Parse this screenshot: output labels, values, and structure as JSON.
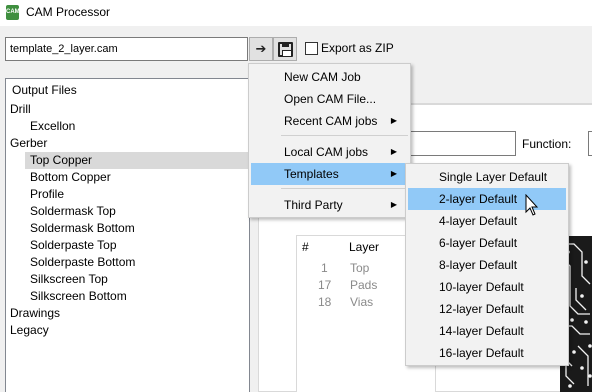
{
  "window": {
    "title": "CAM Processor",
    "icon": "cam-app-icon"
  },
  "toolbar": {
    "file_name": "template_2_layer.cam",
    "run_icon": "➔",
    "save_icon": "save-icon",
    "export_zip_label": "Export as ZIP",
    "export_zip_checked": false
  },
  "tree": {
    "header": "Output Files",
    "items": [
      {
        "label": "Drill"
      },
      {
        "label": "Excellon"
      },
      {
        "label": "Gerber"
      },
      {
        "label": "Top Copper",
        "selected": true
      },
      {
        "label": "Bottom Copper"
      },
      {
        "label": "Profile"
      },
      {
        "label": "Soldermask Top"
      },
      {
        "label": "Soldermask Bottom"
      },
      {
        "label": "Solderpaste Top"
      },
      {
        "label": "Solderpaste Bottom"
      },
      {
        "label": "Silkscreen Top"
      },
      {
        "label": "Silkscreen Bottom"
      },
      {
        "label": "Drawings"
      },
      {
        "label": "Legacy"
      }
    ]
  },
  "form": {
    "function_label": "Function:"
  },
  "layer_table": {
    "headers": [
      "#",
      "Layer"
    ],
    "rows": [
      {
        "num": "1",
        "name": "Top"
      },
      {
        "num": "17",
        "name": "Pads"
      },
      {
        "num": "18",
        "name": "Vias"
      }
    ]
  },
  "main_menu": {
    "items": [
      {
        "label": "New CAM Job"
      },
      {
        "label": "Open CAM File..."
      },
      {
        "label": "Recent CAM jobs",
        "has_submenu": true
      },
      {
        "label": "Local CAM jobs",
        "has_submenu": true
      },
      {
        "label": "Templates",
        "has_submenu": true,
        "highlighted": true
      },
      {
        "label": "Third Party",
        "has_submenu": true
      }
    ]
  },
  "templates_menu": {
    "items": [
      {
        "label": "Single Layer Default"
      },
      {
        "label": "2-layer Default",
        "highlighted": true
      },
      {
        "label": "4-layer Default"
      },
      {
        "label": "6-layer Default"
      },
      {
        "label": "8-layer Default"
      },
      {
        "label": "10-layer Default"
      },
      {
        "label": "12-layer Default"
      },
      {
        "label": "14-layer Default"
      },
      {
        "label": "16-layer Default"
      }
    ]
  },
  "colors": {
    "highlight": "#91c9f7",
    "tree_selection": "#d9d9d9",
    "app_icon": "#3f8f3f"
  }
}
